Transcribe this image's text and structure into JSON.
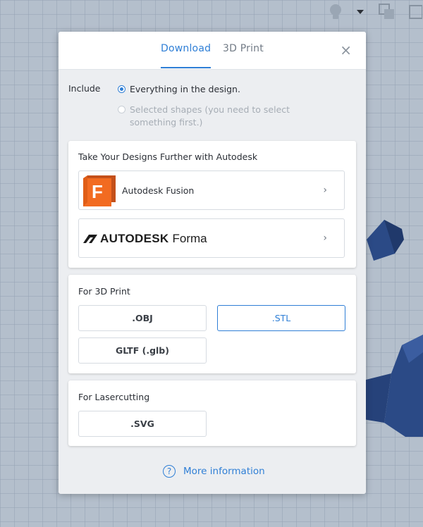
{
  "toolbar": {
    "icons": [
      "lightbulb-icon",
      "chevron-down-icon",
      "shapes-grouping-icon",
      "cube-icon"
    ]
  },
  "dialog": {
    "tabs": [
      {
        "label": "Download",
        "active": true
      },
      {
        "label": "3D Print",
        "active": false
      }
    ],
    "close_glyph": "×",
    "include": {
      "label": "Include",
      "options": [
        {
          "text": "Everything in the design.",
          "selected": true,
          "enabled": true
        },
        {
          "text": "Selected shapes (you need to select something first.)",
          "selected": false,
          "enabled": false
        }
      ]
    },
    "autodesk_card": {
      "title": "Take Your Designs Further with Autodesk",
      "items": [
        {
          "logo_letter": "F",
          "label": "Autodesk Fusion"
        },
        {
          "brand": "AUTODESK",
          "product": "Forma"
        }
      ],
      "chevron": "›"
    },
    "print_card": {
      "title": "For 3D Print",
      "formats": [
        {
          "label": ".OBJ",
          "selected": false
        },
        {
          "label": ".STL",
          "selected": true
        },
        {
          "label": "GLTF (.glb)",
          "selected": false
        }
      ]
    },
    "laser_card": {
      "title": "For Lasercutting",
      "formats": [
        {
          "label": ".SVG",
          "selected": false
        }
      ]
    },
    "more_info": {
      "icon": "?",
      "label": "More information"
    }
  },
  "colors": {
    "accent": "#2f7fd6",
    "fusion_orange": "#f26b21",
    "background_grid": "#b4bfcc",
    "shape_blue": "#2b4a86"
  }
}
